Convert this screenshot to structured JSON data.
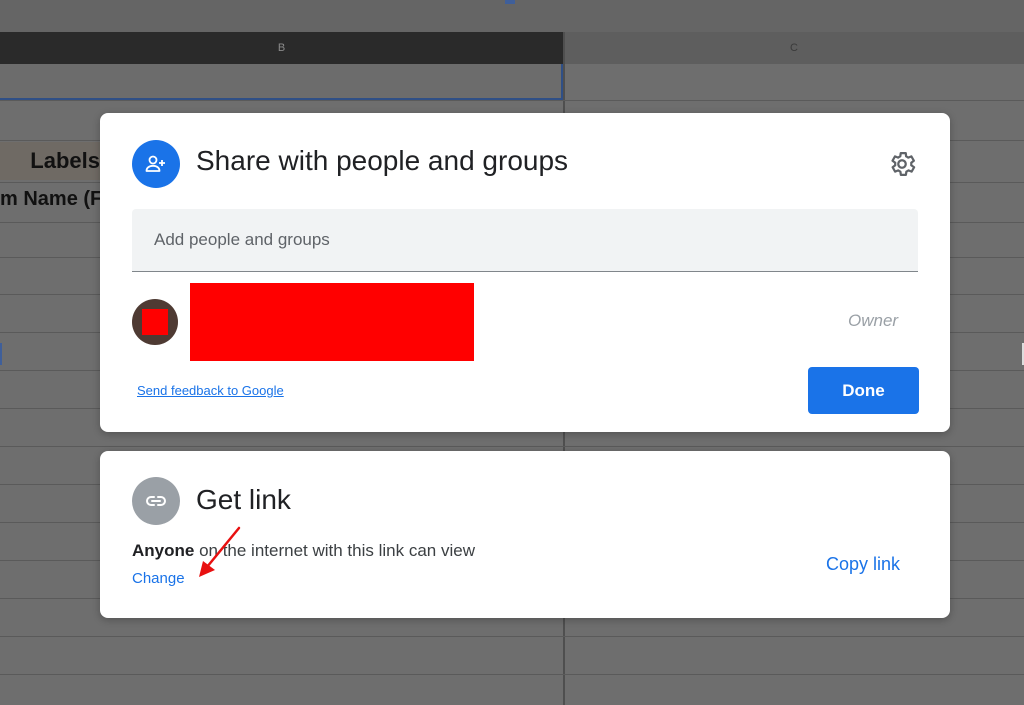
{
  "background": {
    "col_b_header": "B",
    "col_c_header": "C",
    "labels_cell": "Labels",
    "name_cell": "m Name (F"
  },
  "share": {
    "title": "Share with people and groups",
    "add_placeholder": "Add people and groups",
    "owner_role": "Owner",
    "feedback_link": "Send feedback to Google",
    "done_button": "Done",
    "accent_color": "#1a73e8"
  },
  "link": {
    "title": "Get link",
    "access_bold": "Anyone",
    "access_rest": " on the internet with this link can view",
    "change_label": "Change",
    "copy_label": "Copy link"
  },
  "icons": {
    "share": "person-add-icon",
    "link": "link-icon",
    "settings": "gear-icon"
  },
  "annotation_color": "#e81010"
}
